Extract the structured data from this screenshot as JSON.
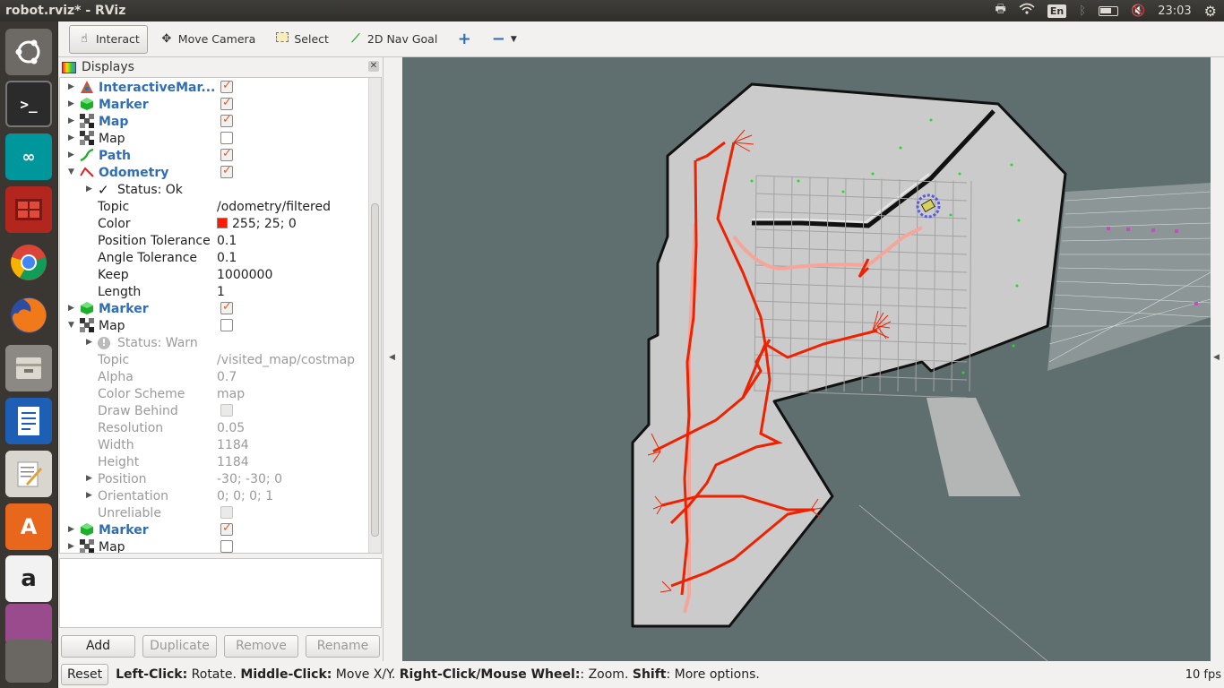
{
  "window": {
    "title": "robot.rviz* - RViz"
  },
  "topbar": {
    "keyboard": "En",
    "clock": "23:03"
  },
  "toolbar": {
    "interact": "Interact",
    "move_camera": "Move Camera",
    "select": "Select",
    "nav_goal": "2D Nav Goal"
  },
  "displays": {
    "title": "Displays",
    "rows": [
      {
        "label": "InteractiveMar...",
        "checked": true
      },
      {
        "label": "Marker",
        "checked": true
      },
      {
        "label": "Map",
        "checked": true
      },
      {
        "label": "Map",
        "checked": false
      },
      {
        "label": "Path",
        "checked": true
      },
      {
        "label": "Odometry",
        "checked": true
      },
      {
        "label": "Status: Ok"
      },
      {
        "label": "Topic",
        "value": "/odometry/filtered"
      },
      {
        "label": "Color",
        "value": "255; 25; 0",
        "swatch": "#ff1900"
      },
      {
        "label": "Position Tolerance",
        "value": "0.1"
      },
      {
        "label": "Angle Tolerance",
        "value": "0.1"
      },
      {
        "label": "Keep",
        "value": "1000000"
      },
      {
        "label": "Length",
        "value": "1"
      },
      {
        "label": "Marker",
        "checked": true
      },
      {
        "label": "Map",
        "checked": false
      },
      {
        "label": "Status: Warn"
      },
      {
        "label": "Topic",
        "value": "/visited_map/costmap"
      },
      {
        "label": "Alpha",
        "value": "0.7"
      },
      {
        "label": "Color Scheme",
        "value": "map"
      },
      {
        "label": "Draw Behind",
        "checked": false
      },
      {
        "label": "Resolution",
        "value": "0.05"
      },
      {
        "label": "Width",
        "value": "1184"
      },
      {
        "label": "Height",
        "value": "1184"
      },
      {
        "label": "Position",
        "value": "-30; -30; 0"
      },
      {
        "label": "Orientation",
        "value": "0; 0; 0; 1"
      },
      {
        "label": "Unreliable",
        "checked": false
      },
      {
        "label": "Marker",
        "checked": true
      },
      {
        "label": "Map",
        "checked": false
      }
    ]
  },
  "buttons": {
    "add": "Add",
    "duplicate": "Duplicate",
    "remove": "Remove",
    "rename": "Rename"
  },
  "status": {
    "reset": "Reset",
    "left_key": "Left-Click:",
    "left_val": " Rotate. ",
    "middle_key": "Middle-Click:",
    "middle_val": " Move X/Y. ",
    "right_key": "Right-Click/Mouse Wheel:",
    "right_val": ": Zoom. ",
    "shift_key": "Shift",
    "shift_val": ": More options.",
    "fps": "10 fps"
  },
  "colors": {
    "path": "#ff2200",
    "map_bg": "#5f6f6f",
    "map_free": "#cbcbcb",
    "grid": "#a0a0a0"
  }
}
